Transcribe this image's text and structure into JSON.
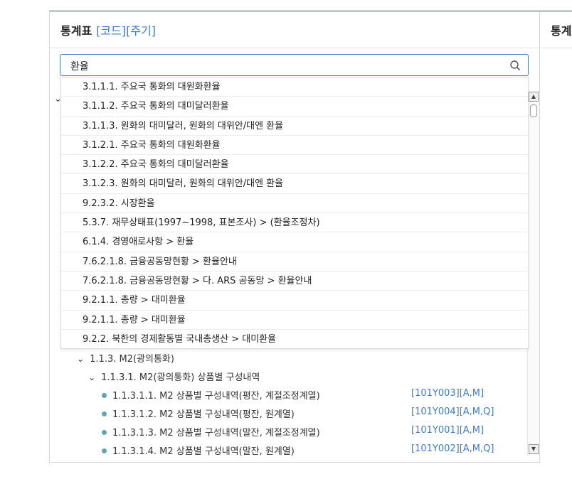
{
  "panel": {
    "title": "통계표",
    "title_accent": "[코드][주기]"
  },
  "right_panel": {
    "title": "통계"
  },
  "search": {
    "value": "환율"
  },
  "dropdown": {
    "items": [
      "3.1.1.1. 주요국 통화의 대원화환율",
      "3.1.1.2. 주요국 통화의 대미달러환율",
      "3.1.1.3. 원화의 대미달러, 원화의 대위안/대엔 환율",
      "3.1.2.1. 주요국 통화의 대원화환율",
      "3.1.2.2. 주요국 통화의 대미달러환율",
      "3.1.2.3. 원화의 대미달러, 원화의 대위안/대엔 환율",
      "9.2.3.2. 시장환율",
      "5.3.7. 재무상태표(1997~1998, 표본조사) > (환율조정차)",
      "6.1.4. 경영애로사항 > 환율",
      "7.6.2.1.8. 금융공동망현황 > 환율안내",
      "7.6.2.1.8. 금융공동망현황 > 다. ARS 공동망 > 환율안내",
      "9.2.1.1. 총량 > 대미환율",
      "9.2.1.1. 총량 > 대미환율",
      "9.2.2. 북한의 경제활동별 국내총생산 > 대미환율"
    ]
  },
  "tree": {
    "node_m2": "1.1.3. M2(광의통화)",
    "node_m2_items": "1.1.3.1. M2(광의통화) 상품별 구성내역",
    "leaves": [
      {
        "label": "1.1.3.1.1. M2 상품별 구성내역(평잔, 계절조정계열)",
        "code": "[101Y003][A,M]"
      },
      {
        "label": "1.1.3.1.2. M2 상품별 구성내역(평잔, 원계열)",
        "code": "[101Y004][A,M,Q]"
      },
      {
        "label": "1.1.3.1.3. M2 상품별 구성내역(말잔, 계절조정계열)",
        "code": "[101Y001][A,M]"
      },
      {
        "label": "1.1.3.1.4. M2 상품별 구성내역(말잔, 원계열)",
        "code": "[101Y002][A,M,Q]"
      }
    ]
  },
  "colors": {
    "accent": "#3a7bd5",
    "leaf_dot": "#5aa7b8"
  },
  "icons": {
    "search": "search-icon",
    "chevron": "chevron-down-icon"
  }
}
